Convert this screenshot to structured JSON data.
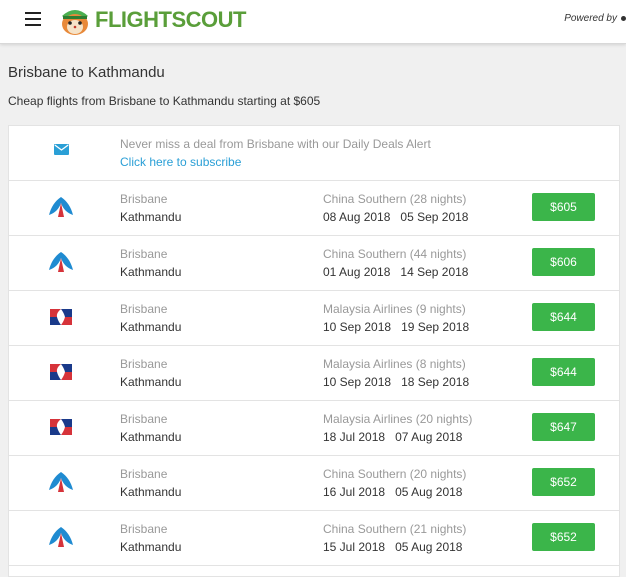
{
  "header": {
    "brand_part1": "FLIGHT",
    "brand_part2": "SCOUT",
    "powered_by": "Powered by"
  },
  "page": {
    "title": "Brisbane to Kathmandu",
    "subtitle": "Cheap flights from Brisbane to Kathmandu starting at $605"
  },
  "subscribe": {
    "text": "Never miss a deal from Brisbane with our Daily Deals Alert",
    "link": "Click here to subscribe"
  },
  "deals": [
    {
      "from": "Brisbane",
      "to": "Kathmandu",
      "airline": "China Southern (28 nights)",
      "depart": "08 Aug 2018",
      "return": "05 Sep 2018",
      "price": "$605",
      "logo": "china-southern-logo"
    },
    {
      "from": "Brisbane",
      "to": "Kathmandu",
      "airline": "China Southern (44 nights)",
      "depart": "01 Aug 2018",
      "return": "14 Sep 2018",
      "price": "$606",
      "logo": "china-southern-logo"
    },
    {
      "from": "Brisbane",
      "to": "Kathmandu",
      "airline": "Malaysia Airlines (9 nights)",
      "depart": "10 Sep 2018",
      "return": "19 Sep 2018",
      "price": "$644",
      "logo": "malaysia-airlines-logo"
    },
    {
      "from": "Brisbane",
      "to": "Kathmandu",
      "airline": "Malaysia Airlines (8 nights)",
      "depart": "10 Sep 2018",
      "return": "18 Sep 2018",
      "price": "$644",
      "logo": "malaysia-airlines-logo"
    },
    {
      "from": "Brisbane",
      "to": "Kathmandu",
      "airline": "Malaysia Airlines (20 nights)",
      "depart": "18 Jul 2018",
      "return": "07 Aug 2018",
      "price": "$647",
      "logo": "malaysia-airlines-logo"
    },
    {
      "from": "Brisbane",
      "to": "Kathmandu",
      "airline": "China Southern (20 nights)",
      "depart": "16 Jul 2018",
      "return": "05 Aug 2018",
      "price": "$652",
      "logo": "china-southern-logo"
    },
    {
      "from": "Brisbane",
      "to": "Kathmandu",
      "airline": "China Southern (21 nights)",
      "depart": "15 Jul 2018",
      "return": "05 Aug 2018",
      "price": "$652",
      "logo": "china-southern-logo"
    }
  ],
  "colors": {
    "price_button": "#3bb54a",
    "link": "#2a9fd6",
    "brand": "#5a9e3a"
  }
}
